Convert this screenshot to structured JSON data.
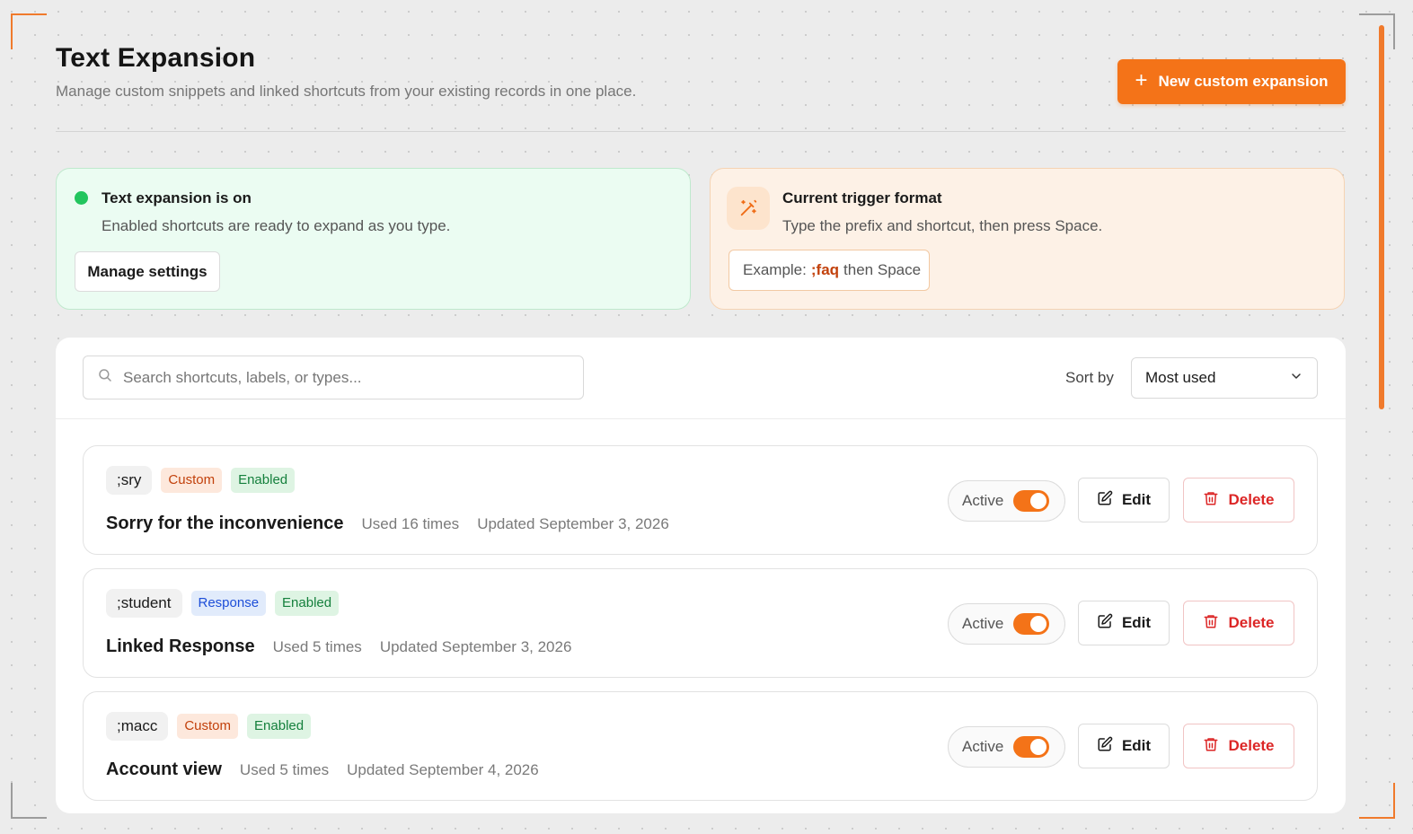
{
  "header": {
    "title": "Text Expansion",
    "subtitle": "Manage custom snippets and linked shortcuts from your existing records in one place.",
    "new_button_label": "New custom expansion",
    "new_button_icon": "plus-icon"
  },
  "status_card": {
    "title": "Text expansion is on",
    "description": "Enabled shortcuts are ready to expand as you type.",
    "button_label": "Manage settings",
    "indicator_color": "#22c55e"
  },
  "trigger_card": {
    "title": "Current trigger format",
    "description": "Type the prefix and shortcut, then press Space.",
    "icon": "magic-wand-icon",
    "example_prefix": "Example:",
    "example_code": ";faq",
    "example_suffix": "then Space"
  },
  "toolbar": {
    "search_placeholder": "Search shortcuts, labels, or types...",
    "sort_label": "Sort by",
    "sort_value": "Most used"
  },
  "rows": [
    {
      "shortcut": ";sry",
      "type": "Custom",
      "state": "Enabled",
      "label": "Sorry for the inconvenience",
      "used": "Used 16 times",
      "updated": "Updated September 3, 2026",
      "active_label": "Active",
      "active": true,
      "edit_label": "Edit",
      "delete_label": "Delete"
    },
    {
      "shortcut": ";student",
      "type": "Response",
      "state": "Enabled",
      "label": "Linked Response",
      "used": "Used 5 times",
      "updated": "Updated September 3, 2026",
      "active_label": "Active",
      "active": true,
      "edit_label": "Edit",
      "delete_label": "Delete"
    },
    {
      "shortcut": ";macc",
      "type": "Custom",
      "state": "Enabled",
      "label": "Account view",
      "used": "Used 5 times",
      "updated": "Updated September 4, 2026",
      "active_label": "Active",
      "active": true,
      "edit_label": "Edit",
      "delete_label": "Delete"
    }
  ],
  "colors": {
    "accent": "#f47318",
    "danger": "#dc2626",
    "success": "#22c55e"
  }
}
